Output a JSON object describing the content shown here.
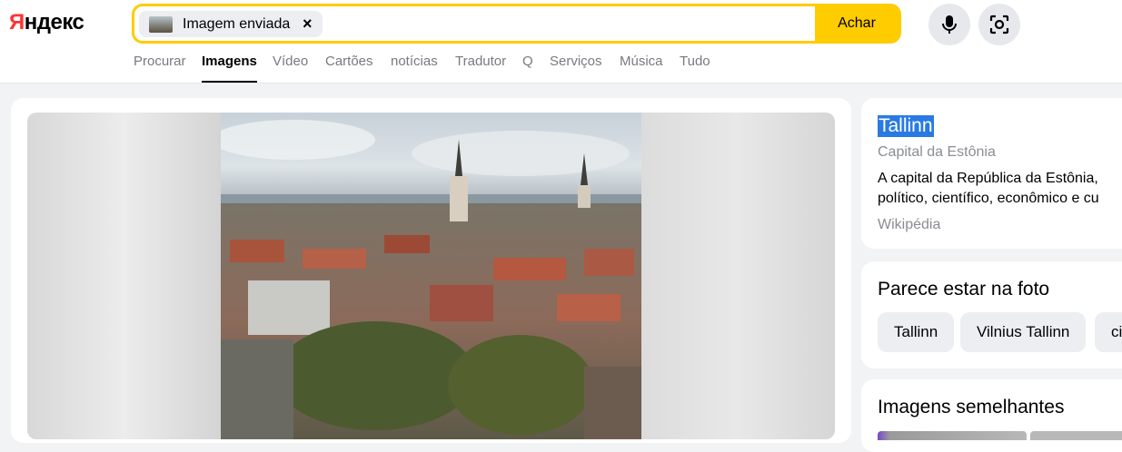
{
  "header": {
    "logo_first": "Я",
    "logo_rest": "ндекс",
    "search_chip_label": "Imagem enviada",
    "search_chip_close": "×",
    "search_button": "Achar",
    "mic_icon": "mic-icon",
    "camera_icon": "lens-icon"
  },
  "tabs": [
    {
      "label": "Procurar",
      "active": false
    },
    {
      "label": "Imagens",
      "active": true
    },
    {
      "label": "Vídeo",
      "active": false
    },
    {
      "label": "Cartões",
      "active": false
    },
    {
      "label": "notícias",
      "active": false
    },
    {
      "label": "Tradutor",
      "active": false
    },
    {
      "label": "Q",
      "active": false
    },
    {
      "label": "Serviços",
      "active": false
    },
    {
      "label": "Música",
      "active": false
    },
    {
      "label": "Tudo",
      "active": false
    }
  ],
  "entity": {
    "title": "Tallinn",
    "subtitle": "Capital da Estônia",
    "description_line1": "A capital da República da Estônia,",
    "description_line2": "político, científico, econômico e cu",
    "source": "Wikipédia"
  },
  "seems_in_photo": {
    "title": "Parece estar na foto",
    "items": [
      "Tallinn",
      "Vilnius Tallinn",
      "ci"
    ]
  },
  "similar_images": {
    "title": "Imagens semelhantes"
  },
  "colors": {
    "accent_yellow": "#ffcc00",
    "selection_blue": "#2a7ae4",
    "logo_red": "#ff3333"
  }
}
